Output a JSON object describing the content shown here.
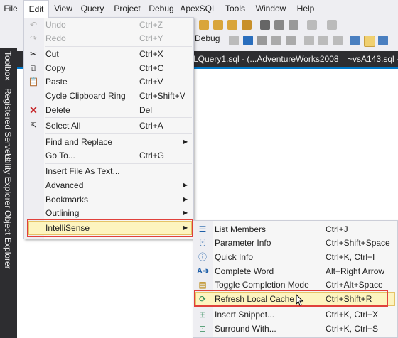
{
  "menubar": {
    "items": [
      "File",
      "Edit",
      "View",
      "Query",
      "Project",
      "Debug",
      "ApexSQL",
      "Tools",
      "Window",
      "Help"
    ]
  },
  "toolbar": {
    "debug_label": "Debug"
  },
  "sidebar": {
    "tabs": [
      "Toolbox",
      "Registered Servers",
      "Utility Explorer",
      "Object Explorer"
    ]
  },
  "doc_tabs": [
    "LQuery1.sql - (...AdventureWorks2008",
    "~vsA143.sql - ("
  ],
  "edit_menu": {
    "items": [
      {
        "label": "Undo",
        "shortcut": "Ctrl+Z",
        "icon": "undo-icon",
        "disabled": true
      },
      {
        "label": "Redo",
        "shortcut": "Ctrl+Y",
        "icon": "redo-icon",
        "disabled": true
      },
      {
        "label": "Cut",
        "shortcut": "Ctrl+X",
        "icon": "scissors-icon"
      },
      {
        "label": "Copy",
        "shortcut": "Ctrl+C",
        "icon": "copy-icon"
      },
      {
        "label": "Paste",
        "shortcut": "Ctrl+V",
        "icon": "paste-icon"
      },
      {
        "label": "Cycle Clipboard Ring",
        "shortcut": "Ctrl+Shift+V"
      },
      {
        "label": "Delete",
        "shortcut": "Del",
        "icon": "delete-x-icon"
      },
      {
        "label": "Select All",
        "shortcut": "Ctrl+A",
        "icon": "select-all-icon"
      },
      {
        "label": "Find and Replace",
        "submenu": true
      },
      {
        "label": "Go To...",
        "shortcut": "Ctrl+G"
      },
      {
        "label": "Insert File As Text..."
      },
      {
        "label": "Advanced",
        "submenu": true
      },
      {
        "label": "Bookmarks",
        "submenu": true
      },
      {
        "label": "Outlining",
        "submenu": true
      },
      {
        "label": "IntelliSense",
        "submenu": true
      }
    ]
  },
  "intellisense_menu": {
    "items": [
      {
        "label": "List Members",
        "shortcut": "Ctrl+J",
        "icon": "list-members-icon"
      },
      {
        "label": "Parameter Info",
        "shortcut": "Ctrl+Shift+Space",
        "icon": "parameter-info-icon"
      },
      {
        "label": "Quick Info",
        "shortcut": "Ctrl+K, Ctrl+I",
        "icon": "quick-info-icon"
      },
      {
        "label": "Complete Word",
        "shortcut": "Alt+Right Arrow",
        "icon": "complete-word-icon"
      },
      {
        "label": "Toggle Completion Mode",
        "shortcut": "Ctrl+Alt+Space",
        "icon": "toggle-completion-icon"
      },
      {
        "label": "Refresh Local Cache",
        "shortcut": "Ctrl+Shift+R",
        "icon": "refresh-cache-icon"
      },
      {
        "label": "Insert Snippet...",
        "shortcut": "Ctrl+K, Ctrl+X",
        "icon": "insert-snippet-icon"
      },
      {
        "label": "Surround With...",
        "shortcut": "Ctrl+K, Ctrl+S",
        "icon": "surround-with-icon"
      }
    ]
  }
}
